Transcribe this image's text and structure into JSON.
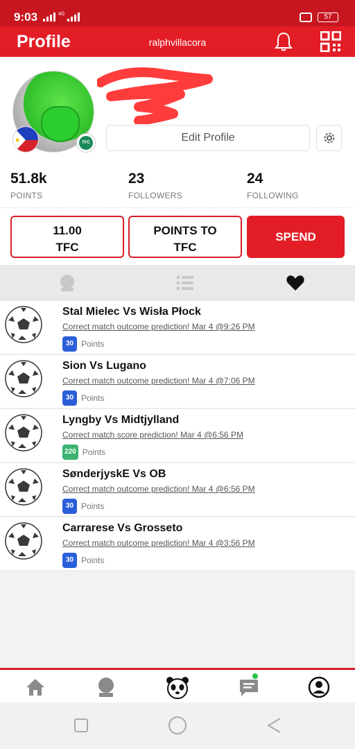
{
  "status_bar": {
    "time": "9:03",
    "network": "4G",
    "battery": "57"
  },
  "header": {
    "title": "Profile",
    "username": "ralphvillacora"
  },
  "profile": {
    "edit_label": "Edit Profile",
    "tfc_badge": "TFC",
    "stats": [
      {
        "value": "51.8k",
        "label": "POINTS"
      },
      {
        "value": "23",
        "label": "FOLLOWERS"
      },
      {
        "value": "24",
        "label": "FOLLOWING"
      }
    ],
    "actions": {
      "balance_line1": "11.00",
      "balance_line2": "TFC",
      "convert_line1": "POINTS TO",
      "convert_line2": "TFC",
      "spend": "SPEND"
    }
  },
  "tabs": [
    {
      "icon": "crystal-ball-icon",
      "active": false
    },
    {
      "icon": "list-icon",
      "active": false
    },
    {
      "icon": "heart-icon",
      "active": true
    }
  ],
  "feed": [
    {
      "title": "Stal Mielec Vs Wisła Płock",
      "detail": "Correct match outcome prediction! Mar 4 @9:26 PM",
      "points": "30",
      "points_label": "Points",
      "badge_color": "#2b5fd9"
    },
    {
      "title": "Sion Vs Lugano",
      "detail": "Correct match outcome prediction! Mar 4 @7:06 PM",
      "points": "30",
      "points_label": "Points",
      "badge_color": "#2b5fd9"
    },
    {
      "title": "Lyngby Vs Midtjylland",
      "detail": "Correct match score prediction! Mar 4 @6:56 PM",
      "points": "220",
      "points_label": "Points",
      "badge_color": "#3cb371"
    },
    {
      "title": "SønderjyskE Vs OB",
      "detail": "Correct match outcome prediction! Mar 4 @6:56 PM",
      "points": "30",
      "points_label": "Points",
      "badge_color": "#2b5fd9"
    },
    {
      "title": "Carrarese Vs Grosseto",
      "detail": "Correct match outcome prediction! Mar 4 @3:56 PM",
      "points": "30",
      "points_label": "Points",
      "badge_color": "#2b5fd9"
    }
  ],
  "bottom_nav": [
    {
      "icon": "home-icon"
    },
    {
      "icon": "crystal-ball-icon"
    },
    {
      "icon": "panda-icon"
    },
    {
      "icon": "chat-icon",
      "notification": true
    },
    {
      "icon": "user-icon"
    }
  ],
  "colors": {
    "brand_red": "#e31d26",
    "status_red": "#c7161f",
    "blue_badge": "#2b5fd9",
    "green_badge": "#3cb371",
    "notification_green": "#27c24c"
  }
}
